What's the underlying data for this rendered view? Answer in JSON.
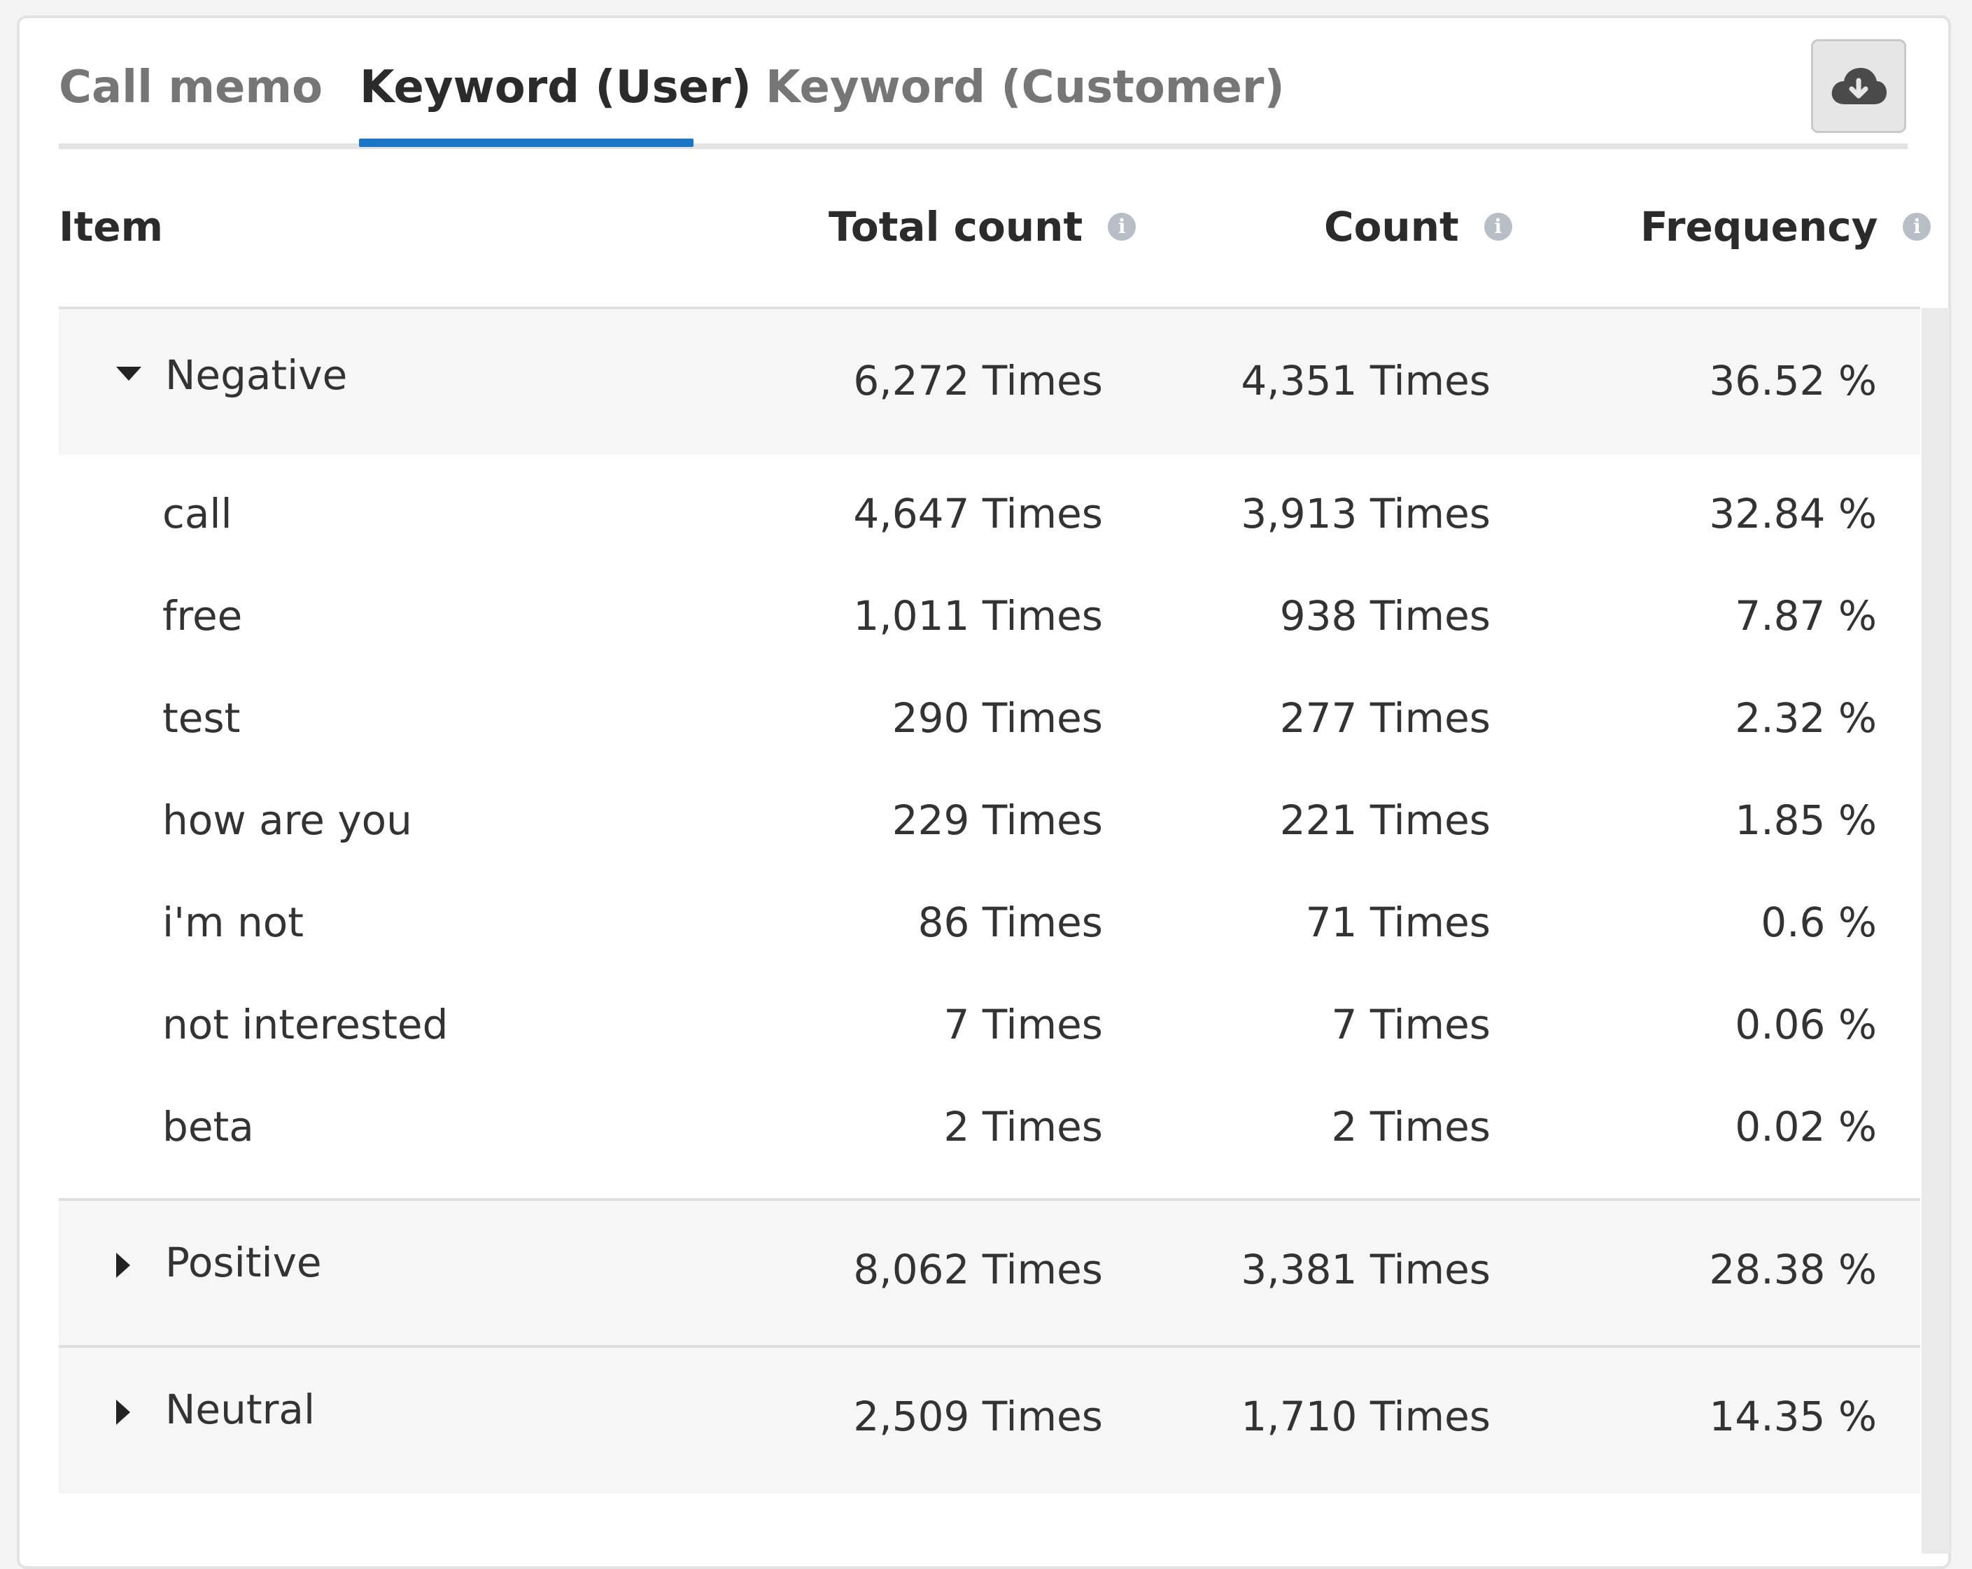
{
  "tabs": [
    {
      "label": "Call memo",
      "active": false
    },
    {
      "label": "Keyword (User)",
      "active": true
    },
    {
      "label": "Keyword (Customer)",
      "active": false
    }
  ],
  "toolbar": {
    "download_icon": "cloud-download-icon"
  },
  "columns": {
    "item": "Item",
    "total_count": "Total count",
    "count": "Count",
    "frequency": "Frequency"
  },
  "groups": [
    {
      "name": "Negative",
      "expanded": true,
      "total": "6,272 Times",
      "count": "4,351 Times",
      "frequency": "36.52 %",
      "children": [
        {
          "name": "call",
          "total": "4,647 Times",
          "count": "3,913 Times",
          "frequency": "32.84 %"
        },
        {
          "name": "free",
          "total": "1,011 Times",
          "count": "938 Times",
          "frequency": "7.87 %"
        },
        {
          "name": "test",
          "total": "290 Times",
          "count": "277 Times",
          "frequency": "2.32 %"
        },
        {
          "name": "how are you",
          "total": "229 Times",
          "count": "221 Times",
          "frequency": "1.85 %"
        },
        {
          "name": "i'm not",
          "total": "86 Times",
          "count": "71 Times",
          "frequency": "0.6 %"
        },
        {
          "name": "not interested",
          "total": "7 Times",
          "count": "7 Times",
          "frequency": "0.06 %"
        },
        {
          "name": "beta",
          "total": "2 Times",
          "count": "2 Times",
          "frequency": "0.02 %"
        }
      ]
    },
    {
      "name": "Positive",
      "expanded": false,
      "total": "8,062 Times",
      "count": "3,381 Times",
      "frequency": "28.38 %"
    },
    {
      "name": "Neutral",
      "expanded": false,
      "total": "2,509 Times",
      "count": "1,710 Times",
      "frequency": "14.35 %"
    }
  ],
  "colors": {
    "accent": "#1d76c5",
    "group_bg": "#f6f6f6",
    "info_icon": "#b8bec6"
  }
}
